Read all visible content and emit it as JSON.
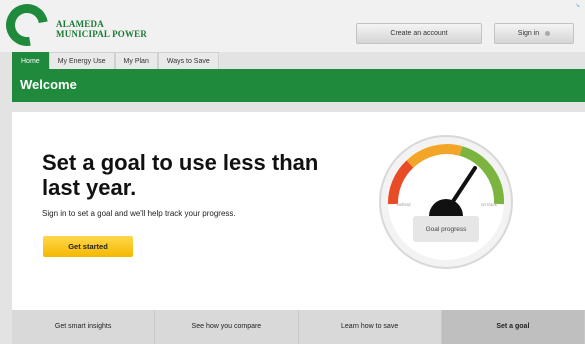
{
  "brand": {
    "line1": "ALAMEDA",
    "line2": "MUNICIPAL POWER"
  },
  "header": {
    "create_account": "Create an account",
    "sign_in": "Sign in"
  },
  "tabs": [
    {
      "label": "Home",
      "active": true
    },
    {
      "label": "My Energy Use",
      "active": false
    },
    {
      "label": "My Plan",
      "active": false
    },
    {
      "label": "Ways to Save",
      "active": false
    }
  ],
  "welcome": "Welcome",
  "hero": {
    "title": "Set a goal to use less than last year.",
    "subtitle": "Sign in to set a goal and we'll help track your progress.",
    "cta": "Get started"
  },
  "gauge": {
    "label": "Goal progress",
    "left_tick": "behind",
    "right_tick": "on track"
  },
  "bottom_tabs": [
    {
      "label": "Get smart insights",
      "active": false
    },
    {
      "label": "See how you compare",
      "active": false
    },
    {
      "label": "Learn how to save",
      "active": false
    },
    {
      "label": "Set a goal",
      "active": true
    }
  ],
  "colors": {
    "brand_green": "#1f8a3c",
    "cta_yellow": "#f4b800",
    "gauge_red": "#e84c24",
    "gauge_orange": "#f2a527",
    "gauge_green": "#7bb540"
  }
}
